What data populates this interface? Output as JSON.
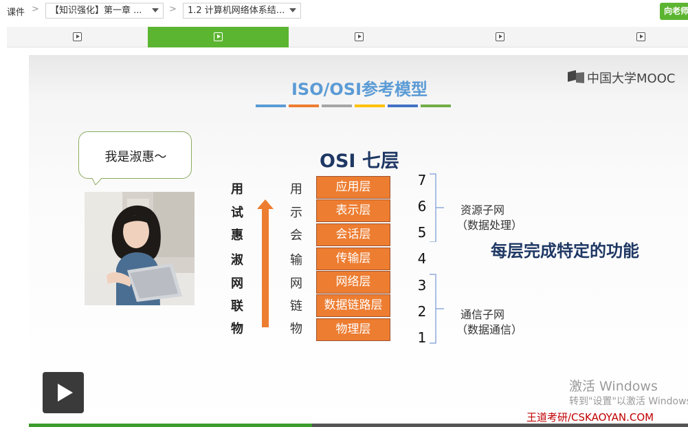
{
  "breadcrumb": {
    "root": "课件",
    "chapter": "【知识强化】第一章 ...",
    "lesson": "1.2 计算机网络体系结..."
  },
  "ask_button": "向老师",
  "unit_tabs": [
    {
      "icon": "video-icon",
      "active": false
    },
    {
      "icon": "video-icon",
      "active": true
    },
    {
      "icon": "video-icon",
      "active": false
    },
    {
      "icon": "video-icon",
      "active": false
    },
    {
      "icon": "video-icon",
      "active": false
    }
  ],
  "slide": {
    "title": "ISO/OSI参考模型",
    "title_bar_colors": [
      "#5b9bd5",
      "#ed7d31",
      "#a5a5a5",
      "#ffc000",
      "#4472c4",
      "#70ad47"
    ],
    "logo_text": "中国大学MOOC",
    "speech": "我是淑惠～",
    "osi_heading": "OSI  七层",
    "mnemonic": [
      "用",
      "试",
      "惠",
      "淑",
      "网",
      "联",
      "物"
    ],
    "abbreviations": [
      "用",
      "示",
      "会",
      "输",
      "网",
      "链",
      "物"
    ],
    "layers": [
      {
        "name": "应用层",
        "number": "7"
      },
      {
        "name": "表示层",
        "number": "6"
      },
      {
        "name": "会话层",
        "number": "5"
      },
      {
        "name": "传输层",
        "number": "4"
      },
      {
        "name": "网络层",
        "number": "3"
      },
      {
        "name": "数据链路层",
        "number": "2"
      },
      {
        "name": "物理层",
        "number": "1"
      }
    ],
    "groups": [
      {
        "title": "资源子网",
        "subtitle": "（数据处理）"
      },
      {
        "title": "通信子网",
        "subtitle": "（数据通信）"
      }
    ],
    "headline": "每层完成特定的功能",
    "watermark": "王道考研/CSKAOYAN.COM"
  },
  "windows_notice": {
    "line1": "激活 Windows",
    "line2": "转到\"设置\"以激活 Windows"
  },
  "player": {
    "progress": 0.43,
    "colors": {
      "accent": "#5cb531",
      "layer_fill": "#ed7d31",
      "heading": "#1f3864"
    }
  }
}
